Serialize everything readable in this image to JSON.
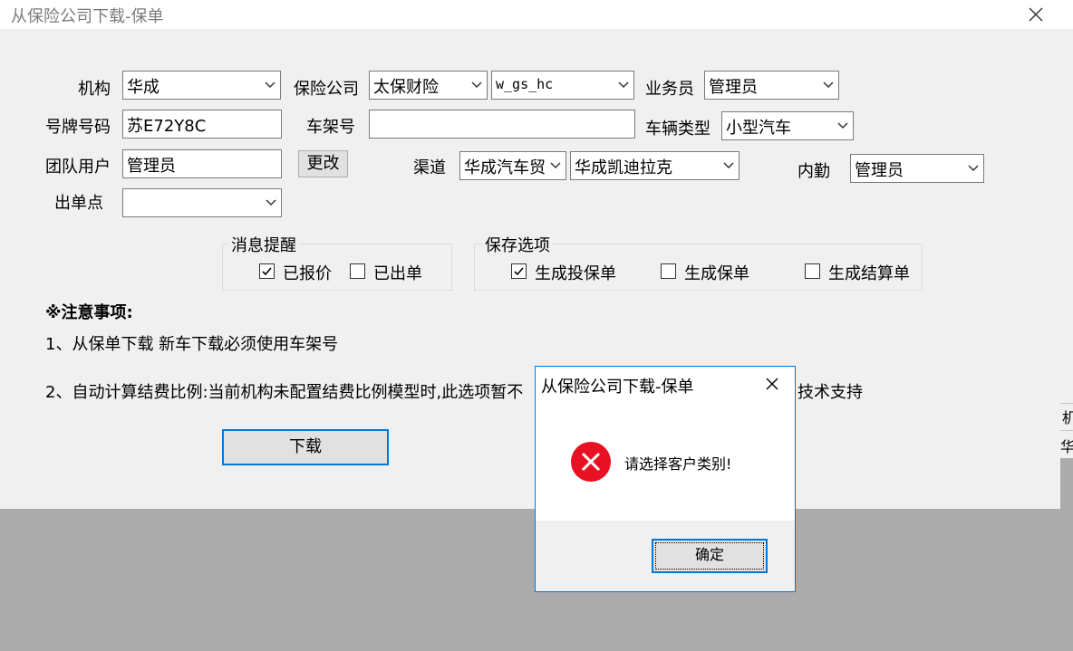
{
  "window": {
    "title": "从保险公司下载-保单"
  },
  "form": {
    "org_label": "机构",
    "org_value": "华成",
    "insurer_label": "保险公司",
    "insurer_value": "太保财险",
    "account_value": "w_gs_hc",
    "salesman_label": "业务员",
    "salesman_value": "管理员",
    "plate_label": "号牌号码",
    "plate_value": "苏E72Y8C",
    "vin_label": "车架号",
    "vin_value": "",
    "vehicle_type_label": "车辆类型",
    "vehicle_type_value": "小型汽车",
    "team_user_label": "团队用户",
    "team_user_value": "管理员",
    "change_button": "更改",
    "channel_label": "渠道",
    "channel_value_1": "华成汽车贸",
    "channel_value_2": "华成凯迪拉克",
    "internal_label": "内勤",
    "internal_value": "管理员",
    "outlet_label": "出单点",
    "outlet_value": ""
  },
  "message_group": {
    "title": "消息提醒",
    "quoted_label": "已报价",
    "quoted_checked": true,
    "issued_label": "已出单",
    "issued_checked": false
  },
  "save_group": {
    "title": "保存选项",
    "gen_proposal_label": "生成投保单",
    "gen_proposal_checked": true,
    "gen_policy_label": "生成保单",
    "gen_policy_checked": false,
    "gen_settlement_label": "生成结算单",
    "gen_settlement_checked": false
  },
  "notes": {
    "heading": "※注意事项:",
    "line1": "1、从保单下载 新车下载必须使用车架号",
    "line2_start": "2、自动计算结费比例:当前机构未配置结费比例模型时,此选项暂不",
    "line2_end": "技术支持"
  },
  "download_button": "下载",
  "dialog": {
    "title": "从保险公司下载-保单",
    "message": "请选择客户类别!",
    "ok_button": "确定"
  },
  "background": {
    "right_glyph_1": "机",
    "right_glyph_2": "华"
  },
  "colors": {
    "accent": "#0078d7",
    "error": "#e81123"
  }
}
